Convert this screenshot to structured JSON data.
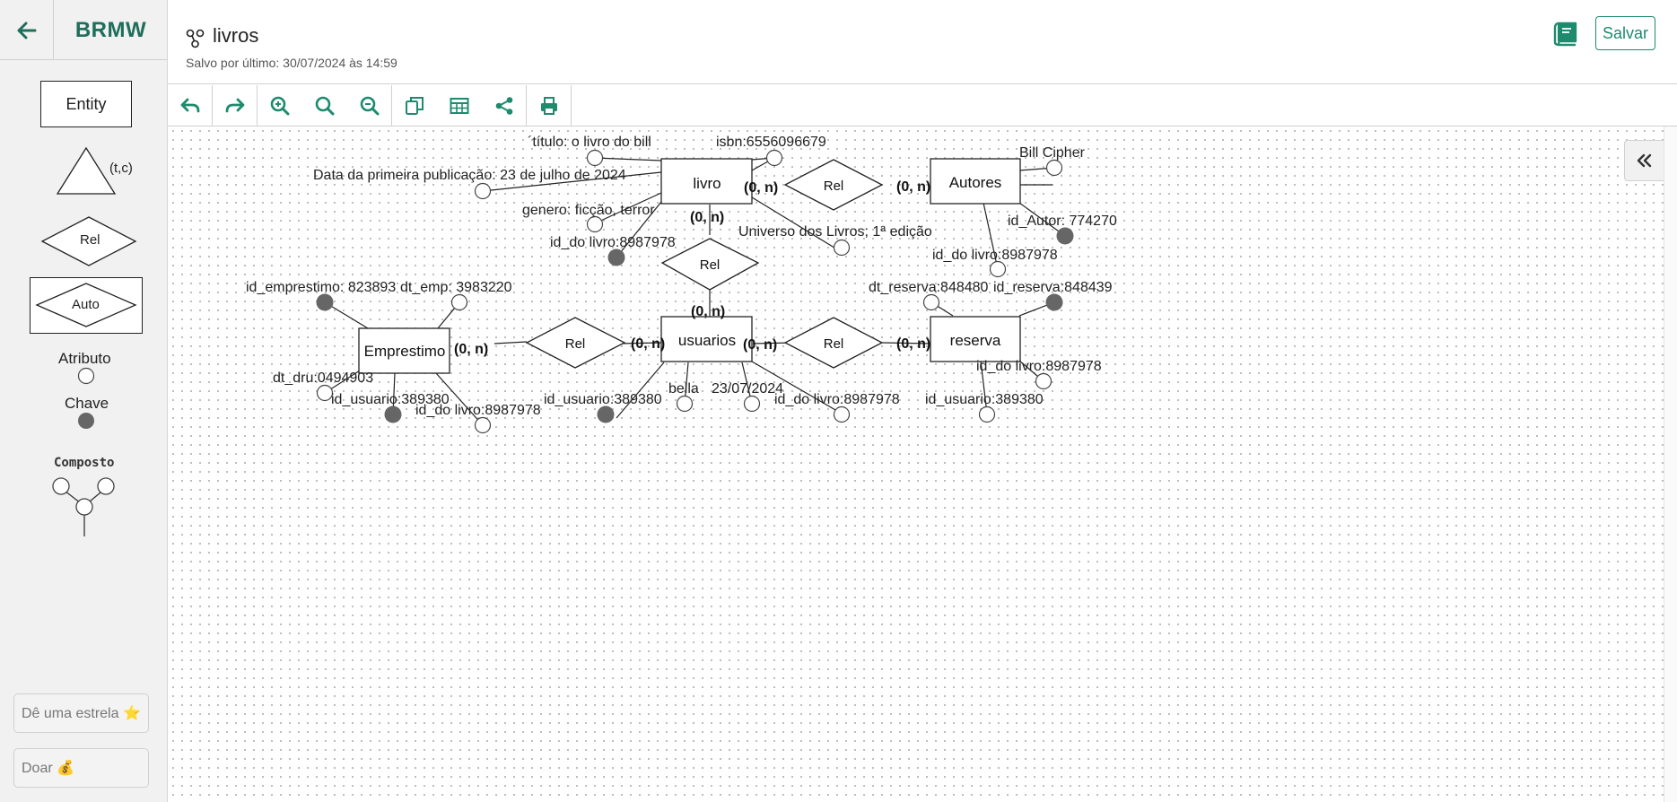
{
  "brand": "BRMW",
  "sidebar": {
    "entity_label": "Entity",
    "spec_label": "(t,c)",
    "rel_label": "Rel",
    "auto_label": "Auto",
    "attribute_label": "Atributo",
    "key_label": "Chave",
    "composite_label": "Composto",
    "star_button": "Dê uma estrela ⭐",
    "donate_button": "Doar 💰"
  },
  "header": {
    "title": "livros",
    "saved_text": "Salvo por último: 30/07/2024 às 14:59",
    "save_button": "Salvar"
  },
  "toolbar": {
    "buttons": [
      "undo-icon",
      "redo-icon",
      "zoom-in-icon",
      "zoom-reset-icon",
      "zoom-out-icon",
      "duplicate-icon",
      "table-icon",
      "share-icon",
      "print-icon"
    ]
  },
  "diagram": {
    "entities": {
      "livro": "livro",
      "autores": "Autores",
      "usuarios": "usuarios",
      "emprestimo": "Emprestimo",
      "reserva": "reserva"
    },
    "relationships": {
      "rel_livro_autores": "Rel",
      "rel_livro_usuarios": "Rel",
      "rel_emprestimo_usuarios": "Rel",
      "rel_usuarios_reserva": "Rel"
    },
    "cardinality": "(0, n)",
    "attributes": {
      "titulo": "´título: o livro do bill",
      "isbn": "isbn:6556096679",
      "data_publicacao": "Data da primeira publicação: 23 de julho de 2024",
      "genero": "genero: ficção, terror",
      "id_do_livro_livro": "id_do livro:8987978",
      "universo": "Universo dos Livros; 1ª edição",
      "bill_cipher": "Bill Cipher",
      "id_autor": "id_Autor: 774270",
      "id_do_livro_autores": "id_do livro:8987978",
      "id_emprestimo": "id_emprestimo: 823893",
      "dt_emp": "dt_emp: 3983220",
      "dt_dru": "dt_dru:0494903",
      "id_usuario_emp": "id_usuario:389380",
      "id_do_livro_emp": "id_do livro:8987978",
      "id_usuario_usr": "id_usuario:389380",
      "bella": "bella",
      "data_usuario": "23/07/2024",
      "id_do_livro_usr": "id_do livro:8987978",
      "dt_reserva": "dt_reserva:848480",
      "id_reserva": "id_reserva:848439",
      "id_do_livro_res": "id_do livro:8987978",
      "id_usuario_res": "id_usuario:389380"
    }
  }
}
